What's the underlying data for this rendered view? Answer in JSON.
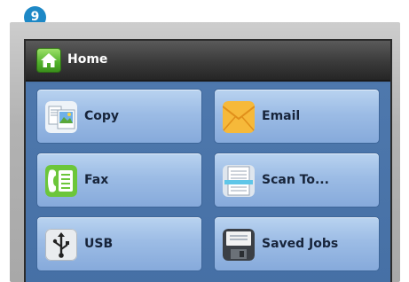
{
  "callout": {
    "number": "9"
  },
  "header": {
    "title": "Home"
  },
  "tiles": [
    {
      "label": "Copy",
      "icon": "copy-icon"
    },
    {
      "label": "Email",
      "icon": "email-icon"
    },
    {
      "label": "Fax",
      "icon": "fax-icon"
    },
    {
      "label": "Scan To...",
      "icon": "scan-icon"
    },
    {
      "label": "USB",
      "icon": "usb-icon"
    },
    {
      "label": "Saved Jobs",
      "icon": "saved-jobs-icon"
    }
  ],
  "colors": {
    "callout": "#1d88c6",
    "screen_background": "#4b74a8",
    "titlebar": "#3a3a3a",
    "home_icon": "#52b22c",
    "tile": "#9cbce5"
  }
}
